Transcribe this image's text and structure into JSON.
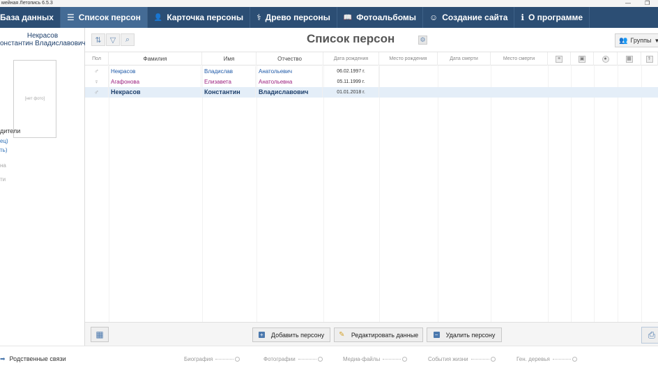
{
  "window": {
    "title": "мейная Летопись  6.5.3",
    "restore_glyph": "❐"
  },
  "menu": [
    {
      "label": "База данных",
      "icon": "",
      "active": false
    },
    {
      "label": "Список персон",
      "icon": "☰",
      "active": true
    },
    {
      "label": "Карточка персоны",
      "icon": "👤",
      "active": false
    },
    {
      "label": "Древо персоны",
      "icon": "⚕",
      "active": false
    },
    {
      "label": "Фотоальбомы",
      "icon": "📖",
      "active": false
    },
    {
      "label": "Создание сайта",
      "icon": "☺",
      "active": false
    },
    {
      "label": "О программе",
      "icon": "ℹ",
      "active": false
    }
  ],
  "left_panel": {
    "name_line1": "Некрасов",
    "name_line2": "онстантин Владиславович",
    "photo_placeholder": "[нет фото]",
    "relatives_header": "дители",
    "link_father": "ец)",
    "link_mother": "ть)",
    "gray1": "на",
    "gray2": "ти"
  },
  "header": {
    "title": "Список персон",
    "groups_label": "Группы",
    "groups_arrow": "▼"
  },
  "table": {
    "columns": {
      "sex": "Пол",
      "surname": "Фамилия",
      "name": "Имя",
      "patronymic": "Отчество",
      "birth_date": "Дата рождения",
      "birth_place": "Место рождения",
      "death_date": "Дата смерти",
      "death_place": "Место смерти"
    },
    "rows": [
      {
        "surname": "Некрасов",
        "name": "Владислав",
        "patronymic": "Анатольевич",
        "birth_date": "06.02.1997 г.",
        "gender": "male"
      },
      {
        "surname": "Агафонова",
        "name": "Елизавета",
        "patronymic": "Анатольевна",
        "birth_date": "05.11.1999 г.",
        "gender": "female"
      },
      {
        "surname": "Некрасов",
        "name": "Константин",
        "patronymic": "Владиславович",
        "birth_date": "01.01.2018 г.",
        "gender": "male"
      }
    ]
  },
  "buttons": {
    "add": "Добавить персону",
    "edit": "Редактировать данные",
    "delete": "Удалить персону"
  },
  "footer": {
    "relatives": "Родственные связи",
    "biography": "Биография",
    "photos": "Фотографии",
    "media": "Медиа-файлы",
    "events": "События жизни",
    "trees": "Ген. деревья"
  },
  "colors": {
    "menu_bg": "#2c4e74",
    "male": "#1f5aa8",
    "female": "#9b1f7e",
    "selected_row": "#e4eef8"
  }
}
